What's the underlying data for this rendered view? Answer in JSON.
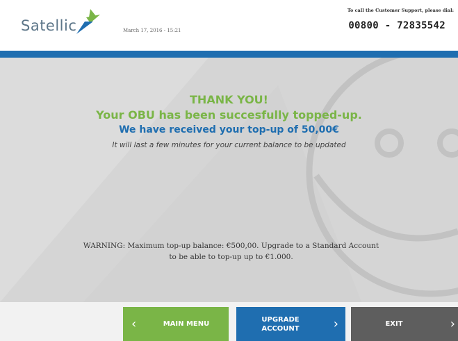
{
  "header": {
    "logo_text": "Satellic",
    "datetime": "March 17, 2016 - 15:21",
    "support_caption": "To call the Customer Support, please dial:",
    "support_phone": "00800 - 72835542"
  },
  "colors": {
    "brand_blue": "#1f6eb0",
    "success_green": "#7ab547",
    "exit_gray": "#5e5e5e"
  },
  "main": {
    "thank_you": "THANK YOU!",
    "success_line": "Your OBU has been succesfully topped-up.",
    "received_line": "We have received your top-up of 50,00€",
    "balance_note": "It will last a few minutes for your current balance to be updated",
    "warning_line1": "WARNING: Maximum top-up balance: €500,00. Upgrade to a Standard Account",
    "warning_line2": "to be able to top-up up to €1.000."
  },
  "footer": {
    "main_menu_label": "MAIN MENU",
    "upgrade_line1": "UPGRADE",
    "upgrade_line2": "ACCOUNT",
    "exit_label": "EXIT",
    "icons": {
      "back": "chevron-left-icon",
      "forward": "chevron-right-icon"
    }
  }
}
